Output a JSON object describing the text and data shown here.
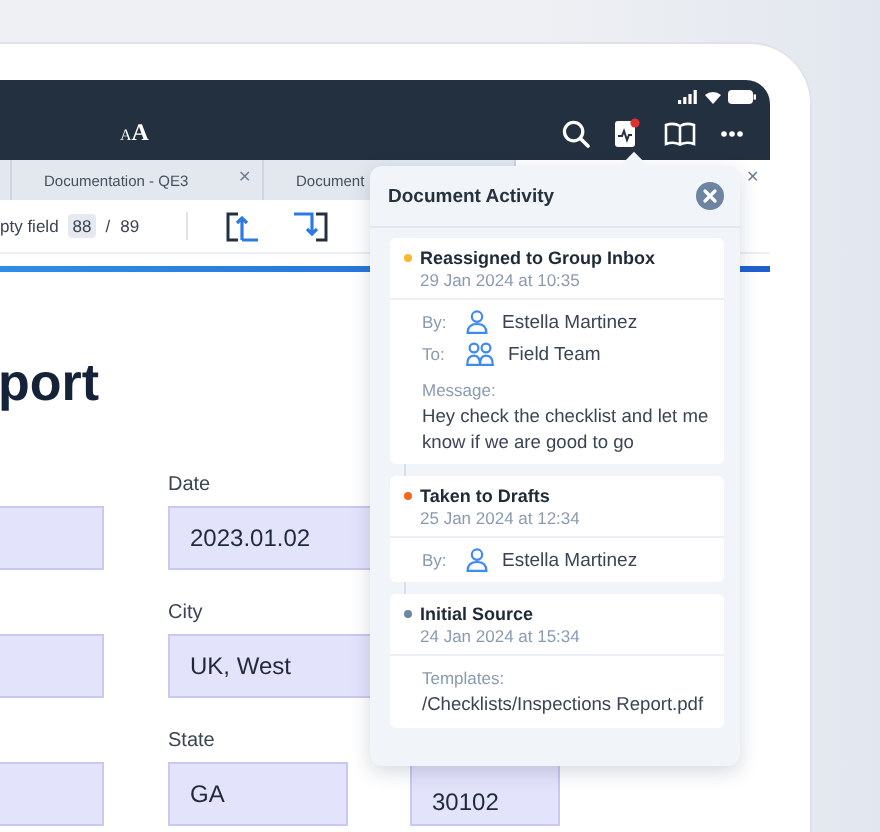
{
  "font_button": {
    "small": "A",
    "large": "A"
  },
  "tabs": [
    {
      "label": "Documentation - QE3",
      "selected": false,
      "close": "✕"
    },
    {
      "label": "Document",
      "selected": false
    },
    {
      "selected": true,
      "close": "✕"
    }
  ],
  "toolbar": {
    "field_label": "pty field",
    "current": "88",
    "separator": "/",
    "total": "89"
  },
  "title": "port",
  "form_rows": [
    {
      "label": "Date",
      "value": "2023.01.02"
    },
    {
      "label": "City",
      "value": "UK, West"
    },
    {
      "label": "State",
      "value": "GA",
      "extra_value": "30102"
    }
  ],
  "activity": {
    "title": "Document Activity",
    "events": [
      {
        "title": "Reassigned to Group Inbox",
        "date": "29 Jan 2024 at 10:35",
        "color": "#f5b82e",
        "details": [
          {
            "kind": "person",
            "label": "By:",
            "value": "Estella Martinez"
          },
          {
            "kind": "group",
            "label": "To:",
            "value": "Field Team"
          },
          {
            "kind": "note",
            "label": "Message:",
            "value": "Hey check the checklist and let me know if we are good to go"
          }
        ]
      },
      {
        "title": "Taken to Drafts",
        "date": "25 Jan 2024 at 12:34",
        "color": "#f26b1d",
        "details": [
          {
            "kind": "person",
            "label": "By:",
            "value": "Estella Martinez"
          }
        ]
      },
      {
        "title": "Initial Source",
        "date": "24 Jan 2024 at 15:34",
        "color": "#6d85a3",
        "details": [
          {
            "kind": "note",
            "label": "Templates:",
            "value": "/Checklists/Inspections Report.pdf"
          }
        ]
      }
    ]
  }
}
